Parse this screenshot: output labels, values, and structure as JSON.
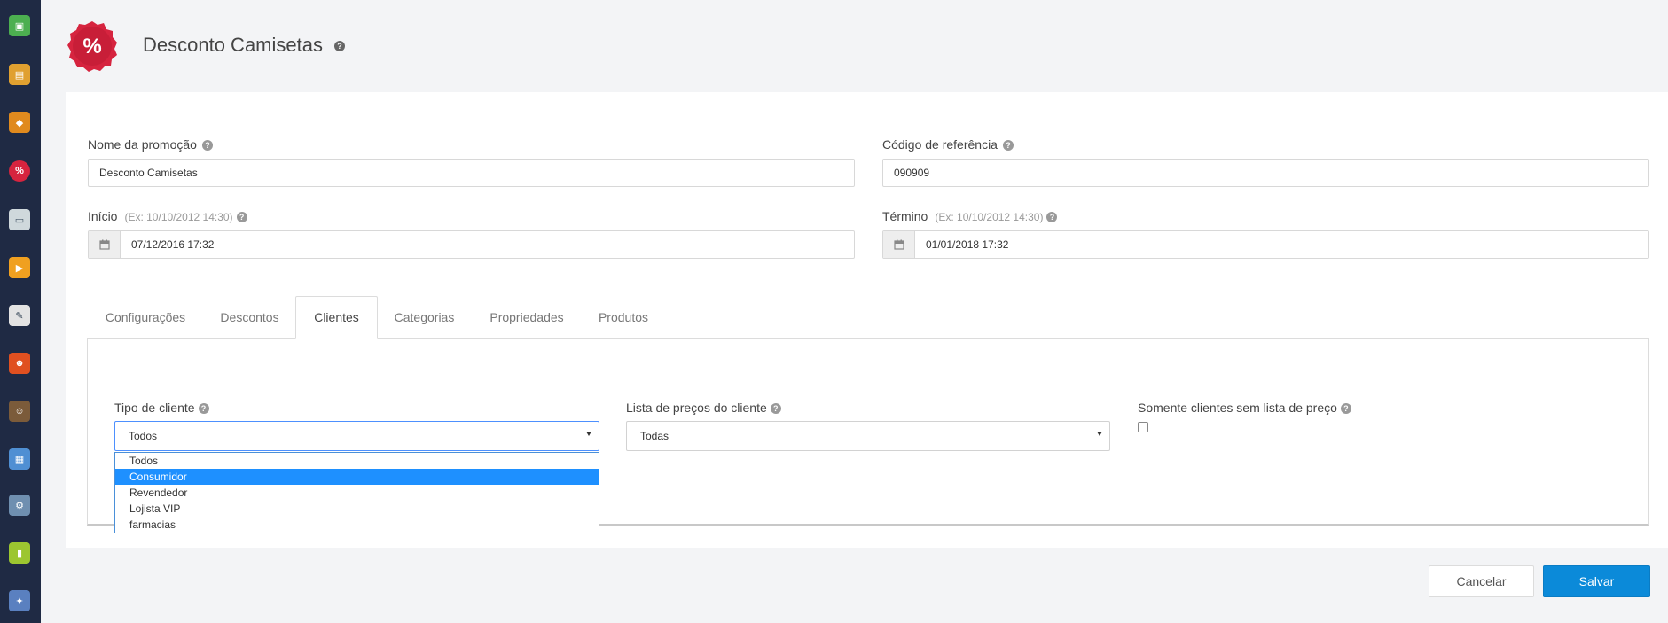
{
  "sidebar": {
    "icons": [
      {
        "name": "box-green-icon",
        "color": "#4caf50"
      },
      {
        "name": "document-orders-icon",
        "color": "#e0a030"
      },
      {
        "name": "products-stack-icon",
        "color": "#e08a1e"
      },
      {
        "name": "promotion-percent-icon",
        "color": "#d6243f"
      },
      {
        "name": "card-payment-icon",
        "color": "#cfd8dc"
      },
      {
        "name": "shipping-truck-icon",
        "color": "#f0a020"
      },
      {
        "name": "notes-icon",
        "color": "#e3e3e3"
      },
      {
        "name": "customers-group-icon",
        "color": "#e05020"
      },
      {
        "name": "user-profile-icon",
        "color": "#7b5b3a"
      },
      {
        "name": "image-gallery-icon",
        "color": "#4f8fd3"
      },
      {
        "name": "settings-device-icon",
        "color": "#6f8fb0"
      },
      {
        "name": "reports-chart-icon",
        "color": "#9cc630"
      },
      {
        "name": "tools-icon",
        "color": "#5a80c0"
      }
    ]
  },
  "header": {
    "title": "Desconto Camisetas",
    "badge_symbol": "%",
    "badge_color": "#d6243f",
    "help_symbol": "?"
  },
  "form": {
    "promo_name": {
      "label": "Nome da promoção",
      "value": "Desconto Camisetas"
    },
    "ref_code": {
      "label": "Código de referência",
      "value": "090909"
    },
    "start": {
      "label": "Início",
      "hint": "(Ex: 10/10/2012 14:30)",
      "value": "07/12/2016 17:32"
    },
    "end": {
      "label": "Término",
      "hint": "(Ex: 10/10/2012 14:30)",
      "value": "01/01/2018 17:32"
    }
  },
  "tabs": [
    {
      "label": "Configurações",
      "active": false
    },
    {
      "label": "Descontos",
      "active": false
    },
    {
      "label": "Clientes",
      "active": true
    },
    {
      "label": "Categorias",
      "active": false
    },
    {
      "label": "Propriedades",
      "active": false
    },
    {
      "label": "Produtos",
      "active": false
    }
  ],
  "clientes": {
    "tipo": {
      "label": "Tipo de cliente",
      "value": "Todos",
      "options": [
        "Todos",
        "Consumidor",
        "Revendedor",
        "Lojista VIP",
        "farmacias"
      ],
      "highlighted": "Consumidor"
    },
    "lista": {
      "label": "Lista de preços do cliente",
      "value": "Todas"
    },
    "somente": {
      "label": "Somente clientes sem lista de preço",
      "checked": false
    }
  },
  "actions": {
    "cancel": "Cancelar",
    "save": "Salvar",
    "accent": "#0b8ad9"
  }
}
